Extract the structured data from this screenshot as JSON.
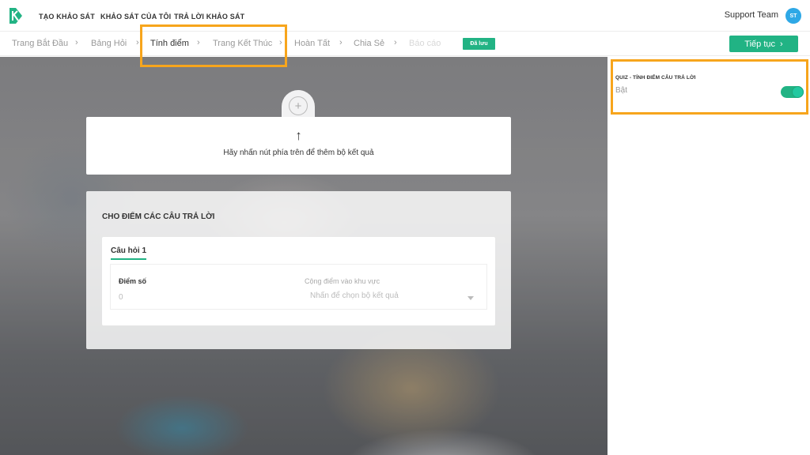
{
  "nav": {
    "items": [
      "TẠO KHẢO SÁT",
      "KHẢO SÁT CỦA TÔI",
      "TRẢ LỜI KHẢO SÁT"
    ],
    "user_name": "Support Team",
    "avatar_initials": "ST"
  },
  "steps": {
    "items": [
      "Trang Bắt Đầu",
      "Bảng Hỏi",
      "Tính điểm",
      "Trang Kết Thúc",
      "Hoàn Tất",
      "Chia Sẻ",
      "Báo cáo"
    ],
    "active": "Tính điểm",
    "chevron": "›",
    "saved_label": "Đã lưu",
    "continue_label": "Tiếp tục",
    "continue_icon": "›"
  },
  "main": {
    "add_icon": "+",
    "up_arrow": "↑",
    "hint": "Hãy nhấn nút phía trên để thêm bộ kết quả",
    "score_title": "CHO ĐIỂM CÁC CÂU TRẢ LỜI",
    "question": {
      "tab_label": "Câu hỏi 1",
      "score_label": "Điểm số",
      "score_value": "0",
      "area_label": "Cộng điểm vào khu vực",
      "area_placeholder": "Nhấn để chọn bộ kết quả"
    }
  },
  "panel": {
    "quiz_title": "QUIZ - TÍNH ĐIỂM CÂU TRẢ LỜI",
    "quiz_state": "Bật",
    "quiz_enabled": true
  },
  "colors": {
    "accent": "#21b384",
    "highlight": "#f7a51c",
    "avatar": "#2ea8e6"
  }
}
